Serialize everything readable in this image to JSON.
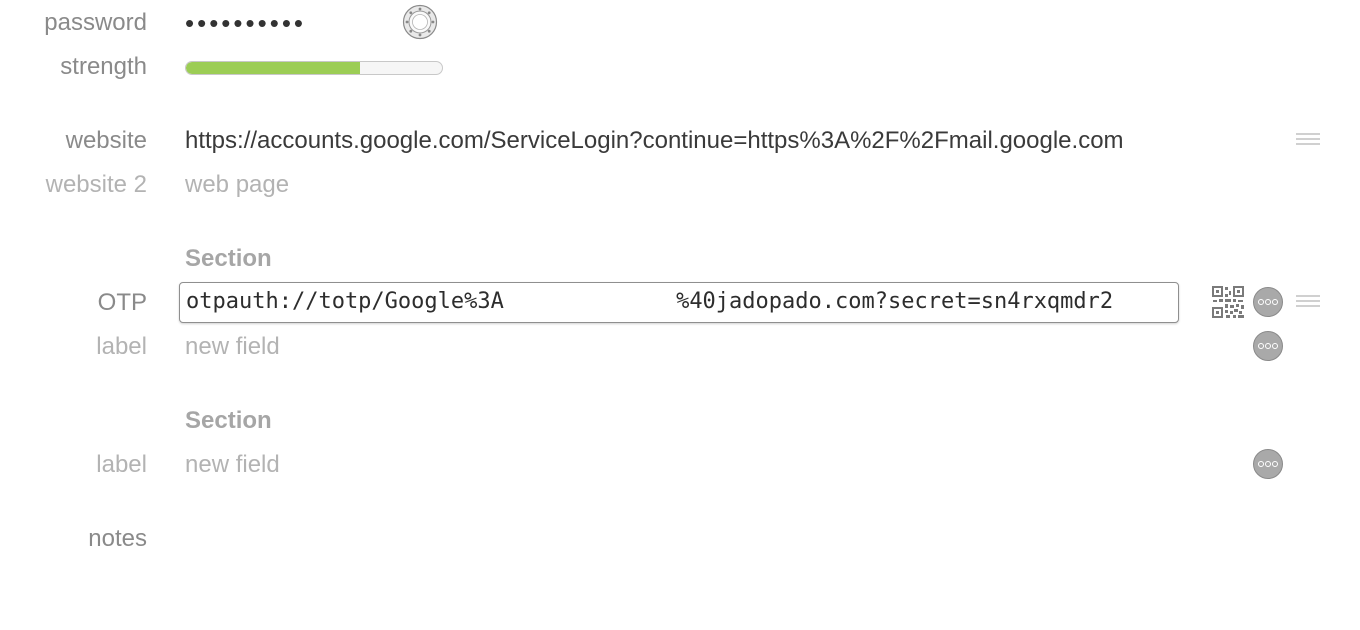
{
  "fields": {
    "password": {
      "label": "password",
      "value": "••••••••••"
    },
    "strength": {
      "label": "strength",
      "fill_fraction": 0.68,
      "color": "#9ccd55"
    },
    "website": {
      "label": "website",
      "value": "https://accounts.google.com/ServiceLogin?continue=https%3A%2F%2Fmail.google.com"
    },
    "website2": {
      "label": "website 2",
      "placeholder": "web page"
    }
  },
  "sections": [
    {
      "title": "Section",
      "otp": {
        "label": "OTP",
        "value": "otpauth://totp/Google%3A             %40jadopado.com?secret=sn4rxqmdr2"
      },
      "new_field": {
        "label": "label",
        "placeholder": "new field"
      }
    },
    {
      "title": "Section",
      "new_field": {
        "label": "label",
        "placeholder": "new field"
      }
    }
  ],
  "notes": {
    "label": "notes"
  },
  "icons": {
    "password_generator": "password-generator-icon",
    "qr": "qr-code-icon",
    "more": "more-options-icon",
    "drag": "drag-handle-icon"
  }
}
